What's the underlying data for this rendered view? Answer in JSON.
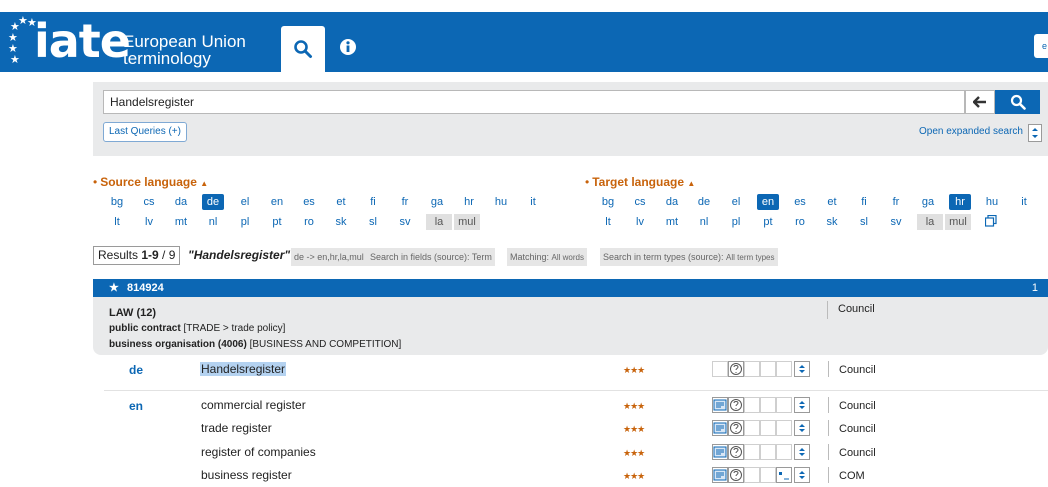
{
  "header": {
    "logo_text": "iate",
    "logo_subtitle": "European Union terminology",
    "corner_label": "e"
  },
  "search": {
    "query": "Handelsregister",
    "last_queries_label": "Last Queries (+)",
    "open_expanded_label": "Open expanded search"
  },
  "source_language": {
    "heading": "Source language",
    "row1": [
      "bg",
      "cs",
      "da",
      "de",
      "el",
      "en",
      "es",
      "et",
      "fi",
      "fr",
      "ga",
      "hr",
      "hu",
      "it"
    ],
    "row2": [
      "lt",
      "lv",
      "mt",
      "nl",
      "pl",
      "pt",
      "ro",
      "sk",
      "sl",
      "sv",
      "la",
      "mul"
    ],
    "selected": [
      "de"
    ]
  },
  "target_language": {
    "heading": "Target language",
    "row1": [
      "bg",
      "cs",
      "da",
      "de",
      "el",
      "en",
      "es",
      "et",
      "fi",
      "fr",
      "ga",
      "hr",
      "hu",
      "it"
    ],
    "row2": [
      "lt",
      "lv",
      "mt",
      "nl",
      "pl",
      "pt",
      "ro",
      "sk",
      "sl",
      "sv",
      "la",
      "mul"
    ],
    "selected": [
      "en",
      "hr"
    ]
  },
  "results": {
    "count_prefix": "Results ",
    "count_range": "1-9",
    "count_total": " / 9",
    "term": "\"Handelsregister\"",
    "chips": {
      "languages": "de -> en,hr,la,mul",
      "fields": "Search in fields (source): Term",
      "matching_label": "Matching: ",
      "matching_value": "All words",
      "term_types_label": "Search in term types (source): ",
      "term_types_value": "All term types"
    }
  },
  "entry": {
    "id": "814924",
    "index": "1",
    "domain_main": "LAW (12)",
    "domain2_bold": "public contract",
    "domain2_rest": " [TRADE > trade policy]",
    "domain3_bold": "business organisation (4006)",
    "domain3_rest": " [BUSINESS AND COMPETITION]",
    "entry_source": "Council",
    "language_blocks": [
      {
        "lang": "de",
        "terms": [
          {
            "text": "Handelsregister",
            "stars": "★★★",
            "source": "Council",
            "reliability": 3
          }
        ]
      },
      {
        "lang": "en",
        "terms": [
          {
            "text": "commercial register",
            "stars": "★★★",
            "source": "Council",
            "reliability": 3
          },
          {
            "text": "trade register",
            "stars": "★★★",
            "source": "Council",
            "reliability": 3
          },
          {
            "text": "register of companies",
            "stars": "★★★",
            "source": "Council",
            "reliability": 3
          },
          {
            "text": "business register",
            "stars": "★★★",
            "source": "COM",
            "reliability": 3
          }
        ]
      }
    ]
  },
  "colors": {
    "brand_blue": "#0c67b4",
    "accent_orange": "#c8630b",
    "panel_grey": "#e9eaeb",
    "highlight": "#b4d2f0"
  }
}
